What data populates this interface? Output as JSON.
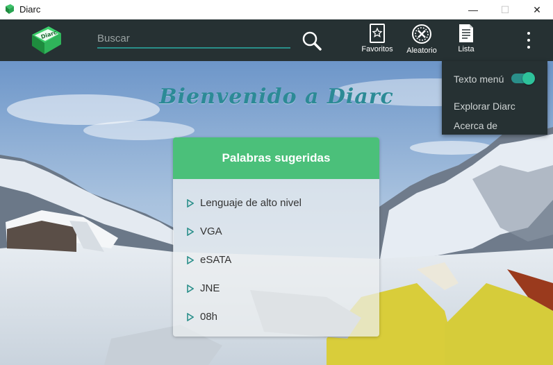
{
  "window": {
    "title": "Diarc",
    "minimize_glyph": "—",
    "maximize_glyph": "☐",
    "close_glyph": "✕"
  },
  "toolbar": {
    "logo_text": "Diarc",
    "search": {
      "placeholder": "Buscar",
      "value": ""
    },
    "buttons": [
      {
        "label": "Favoritos",
        "icon": "star-card-icon"
      },
      {
        "label": "Aleatorio",
        "icon": "shuffle-x-icon"
      },
      {
        "label": "Lista",
        "icon": "list-document-icon"
      }
    ]
  },
  "main": {
    "welcome": "Bienvenido a Diarc",
    "suggestions": {
      "title": "Palabras sugeridas",
      "items": [
        "Lenguaje de alto nivel",
        "VGA",
        "eSATA",
        "JNE",
        "08h"
      ]
    }
  },
  "menu": {
    "items": [
      {
        "label": "Texto menú",
        "toggle": true
      },
      {
        "label": "Explorar Diarc"
      },
      {
        "label": "Acerca de"
      }
    ]
  },
  "colors": {
    "toolbar_bg": "#263133",
    "accent_teal": "#2a8f8a",
    "card_header_green": "#4bc07a",
    "welcome_text": "#2c8a96",
    "logo_green": "#2fb45a"
  }
}
